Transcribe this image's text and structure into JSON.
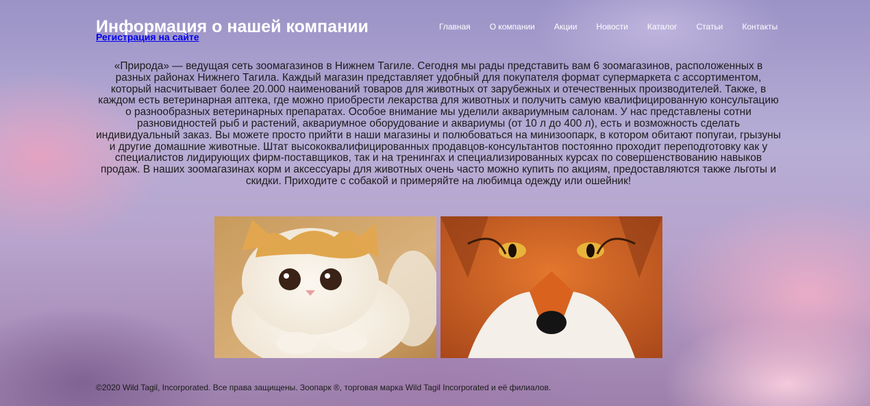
{
  "header": {
    "title": "Информация о нашей компании",
    "register_link": "Регистрация на сайте"
  },
  "nav": {
    "items": [
      "Главная",
      "О компании",
      "Акции",
      "Новости",
      "Каталог",
      "Статьи",
      "Контакты"
    ]
  },
  "main": {
    "intro_text": "«Природа» — ведущая сеть зоомагазинов в Нижнем Тагиле. Сегодня мы рады представить вам 6 зоомагазинов, расположенных в разных районах Нижнего Тагила. Каждый магазин представляет удобный для покупателя формат супермаркета с ассортиментом, который насчитывает более 20.000 наименований товаров для животных от зарубежных и отечественных производителей. Также, в каждом есть ветеринарная аптека, где можно приобрести лекарства для животных и получить самую квалифицированную консультацию о разнообразных ветеринарных препаратах. Особое внимание мы уделили аквариумным салонам. У нас представлены сотни разновидностей рыб и растений, аквариумное оборудование и аквариумы (от 10 л до 400 л), есть и возможность сделать индивидуальный заказ. Вы можете просто прийти в наши магазины и полюбоваться на минизоопарк, в котором обитают попугаи, грызуны и другие домашние животные. Штат высококвалифицированных продавцов-консультантов постоянно проходит переподготовку как у специалистов лидирующих фирм-поставщиков, так и на тренингах и специализированных курсах по совершенствованию навыков продаж. В наших зоомагазинах корм и аксессуары для животных очень часто можно купить по акциям, предоставляются также льготы и скидки. Приходите с собакой и примеряйте на любимца одежду или ошейник!"
  },
  "footer": {
    "copyright": "©2020 Wild Tagil, Incorporated. Все права защищены. Зоопарк ®, торговая марка Wild Tagil Incorporated и её филиалов."
  },
  "colors": {
    "title": "#ffffff",
    "link": "#0000ee",
    "nav_text": "#ffffff",
    "body_text": "#1c1c1c"
  }
}
